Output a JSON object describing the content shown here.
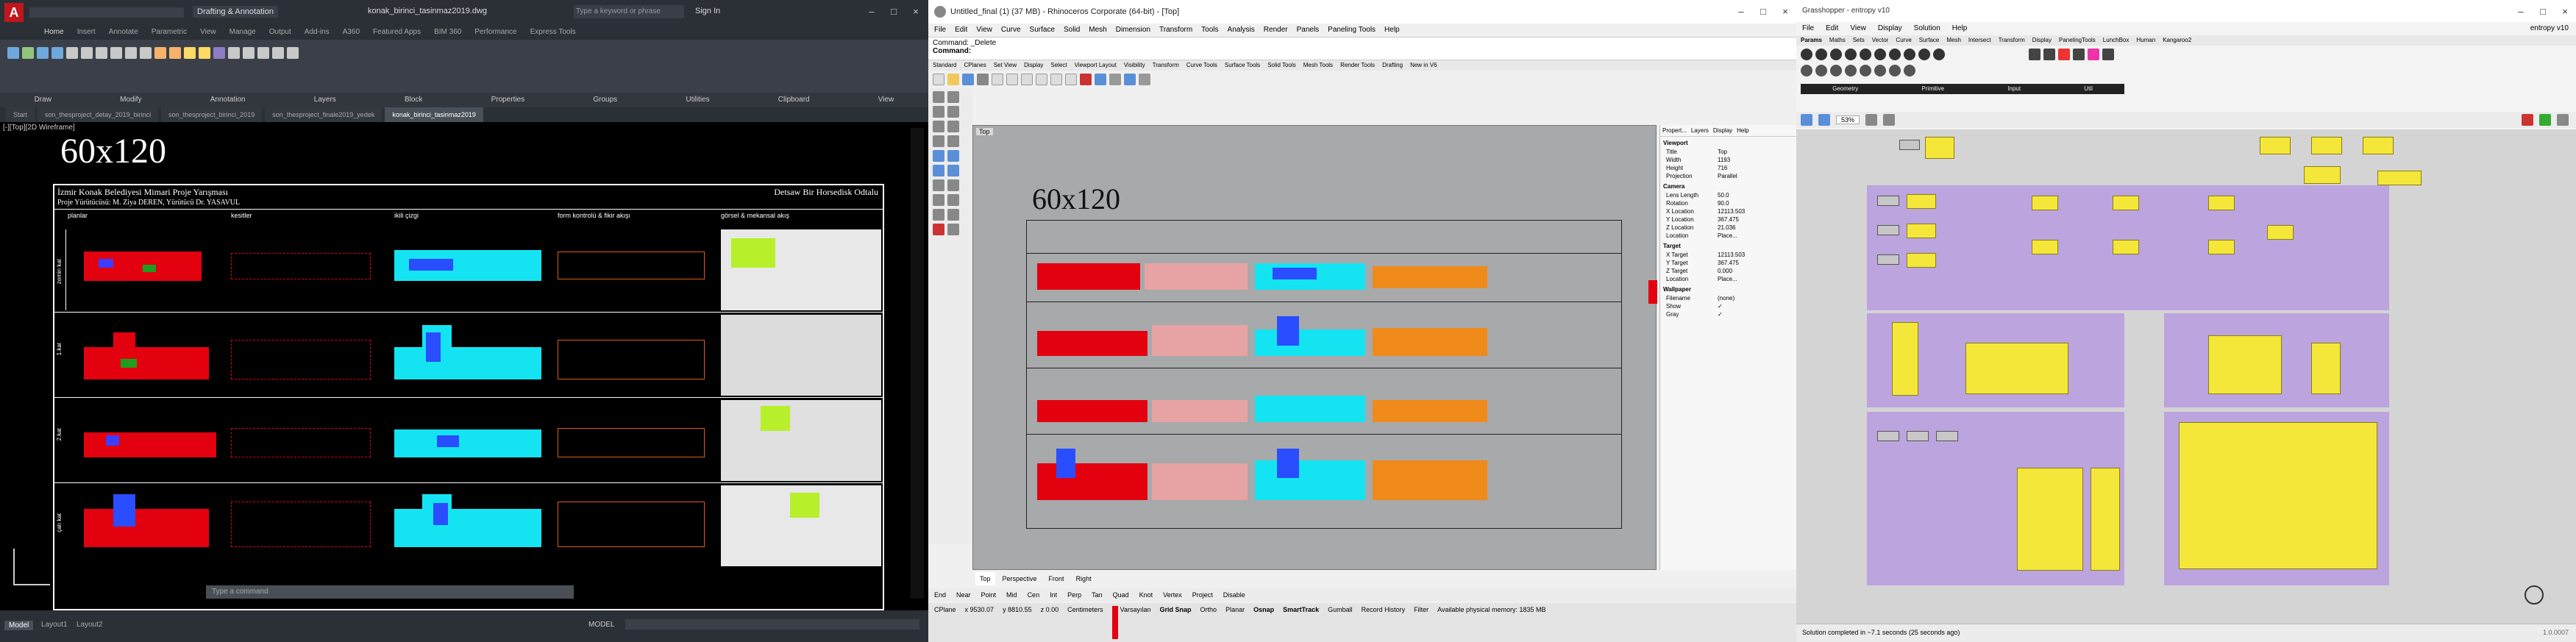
{
  "autocad": {
    "title": "konak_birinci_tasinmaz2019.dwg",
    "workspace": "Drafting & Annotation",
    "search_placeholder": "Type a keyword or phrase",
    "user": "Sign In",
    "menu": [
      "Home",
      "Insert",
      "Annotate",
      "Parametric",
      "View",
      "Manage",
      "Output",
      "Add-ins",
      "A360",
      "Featured Apps",
      "BIM 360",
      "Performance",
      "Express Tools"
    ],
    "panels": [
      "Draw",
      "Modify",
      "Annotation",
      "Layers",
      "Block",
      "Properties",
      "Groups",
      "Utilities",
      "Clipboard",
      "View"
    ],
    "doc_tabs": [
      "Start",
      "son_thesproject_detay_2019_birinci",
      "son_thesproject_birinci_2019",
      "son_thesproject_finale2019_yedek",
      "konak_birinci_tasinmaz2019"
    ],
    "viewport_label": "[-][Top][2D Wireframe]",
    "sheet_title": "60x120",
    "sheet_subtitle": "İzmir Konak Belediyesi Mimari Proje Yarışması",
    "sheet_right": "Detsaw  Bir  Horsedisk  Odtalu",
    "sheet_note": "Proje Yürütücüsü: M. Ziya DEREN, Yürütücü Dr. YASAVUL",
    "col_headers": [
      "planlar",
      "kesitler",
      "ikili çizgi",
      "form kontrolü & fikir akışı",
      "görsel & mekansal akış"
    ],
    "command_placeholder": "Type a command",
    "status_tabs": [
      "Model",
      "Layout1",
      "Layout2"
    ],
    "status_mode": "MODEL",
    "row_labels": [
      "zemin kat",
      "1.kat",
      "2.kat",
      "çatı kat"
    ]
  },
  "rhino": {
    "title": "Untitled_final (1) (37 MB) - Rhinoceros Corporate (64-bit) - [Top]",
    "menu": [
      "File",
      "Edit",
      "View",
      "Curve",
      "Surface",
      "Solid",
      "Mesh",
      "Dimension",
      "Transform",
      "Tools",
      "Analysis",
      "Render",
      "Panels",
      "Paneling Tools",
      "Help"
    ],
    "command_line": "Command: _Delete",
    "command_prompt": "Command:",
    "toolbar_tabs": [
      "Standard",
      "CPlanes",
      "Set View",
      "Display",
      "Select",
      "Viewport Layout",
      "Visibility",
      "Transform",
      "Curve Tools",
      "Surface Tools",
      "Solid Tools",
      "Mesh Tools",
      "Render Tools",
      "Drafting",
      "New in V6"
    ],
    "viewport_label": "Top",
    "sheet_title": "60x120",
    "viewport_tabs": [
      "Top",
      "Perspective",
      "Front",
      "Right"
    ],
    "osnaps": [
      "End",
      "Near",
      "Point",
      "Mid",
      "Cen",
      "Int",
      "Perp",
      "Tan",
      "Quad",
      "Knot",
      "Vertex",
      "Project",
      "Disable"
    ],
    "status": {
      "cplane": "CPlane",
      "x": "x 9530.07",
      "y": "y 8810.55",
      "z": "z 0.00",
      "units": "Centimeters",
      "layer": "Varsayılan",
      "toggles": [
        "Grid Snap",
        "Ortho",
        "Planar",
        "Osnap",
        "SmartTrack",
        "Gumball",
        "Record History",
        "Filter"
      ],
      "memory": "Available physical memory: 1835 MB"
    },
    "panel_tabs": [
      "Propert...",
      "Layers",
      "Display",
      "Help"
    ],
    "panel_section_viewport": "Viewport",
    "panel_rows": [
      {
        "label": "Title",
        "value": "Top"
      },
      {
        "label": "Width",
        "value": "1193"
      },
      {
        "label": "Height",
        "value": "716"
      },
      {
        "label": "Projection",
        "value": "Parallel"
      }
    ],
    "panel_section_camera": "Camera",
    "camera_rows": [
      {
        "label": "Lens Length",
        "value": "50.0"
      },
      {
        "label": "Rotation",
        "value": "90.0"
      },
      {
        "label": "X Location",
        "value": "12113.503"
      },
      {
        "label": "Y Location",
        "value": "367.475"
      },
      {
        "label": "Z Location",
        "value": "21.036"
      },
      {
        "label": "Location",
        "value": "Place..."
      }
    ],
    "panel_section_target": "Target",
    "target_rows": [
      {
        "label": "X Target",
        "value": "12113.503"
      },
      {
        "label": "Y Target",
        "value": "367.475"
      },
      {
        "label": "Z Target",
        "value": "0.000"
      },
      {
        "label": "Location",
        "value": "Place..."
      }
    ],
    "panel_section_wallpaper": "Wallpaper",
    "wallpaper_rows": [
      {
        "label": "Filename",
        "value": "(none)"
      },
      {
        "label": "Show",
        "value": "✓"
      },
      {
        "label": "Gray",
        "value": "✓"
      }
    ]
  },
  "grasshopper": {
    "title": "Grasshopper - entropy v10",
    "menu": [
      "File",
      "Edit",
      "View",
      "Display",
      "Solution",
      "Help"
    ],
    "doc_name": "entropy v10",
    "ribbon_tabs": [
      "Params",
      "Maths",
      "Sets",
      "Vector",
      "Curve",
      "Surface",
      "Mesh",
      "Intersect",
      "Transform",
      "Display",
      "PanelingTools",
      "LunchBox",
      "Human",
      "Kangaroo2"
    ],
    "ribbon_groups": [
      "Geometry",
      "Primitive",
      "Input",
      "Util"
    ],
    "zoom": "53%",
    "status": "Solution completed in ~7.1 seconds (25 seconds ago)",
    "version": "1.0.0007"
  },
  "colors": {
    "acad_bg": "#000000",
    "rhino_viewport": "#a7a9ab",
    "gh_canvas": "#d4d4d4",
    "group": "#b79be0",
    "node": "#f5e73a",
    "accent_red": "#e3000f"
  }
}
